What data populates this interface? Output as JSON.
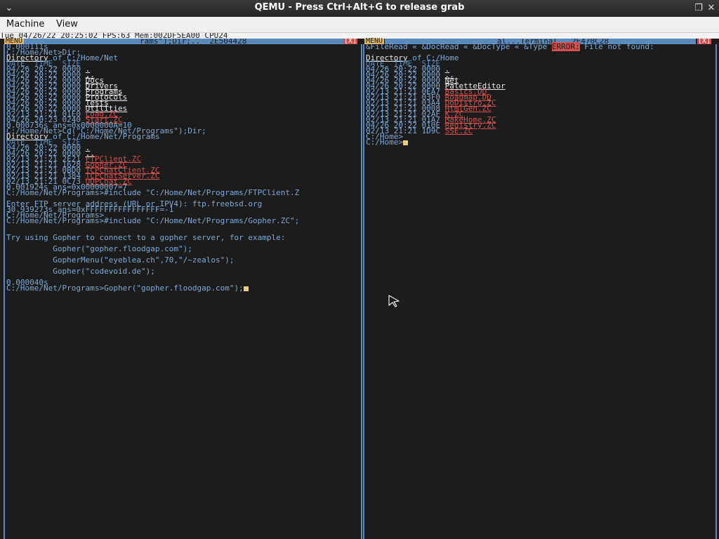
{
  "window": {
    "title": "QEMU - Press Ctrl+Alt+G to release grab",
    "collapse_icon": "⌄",
    "restore_icon": "❐",
    "close_icon": "✕"
  },
  "menubar": {
    "machine": "Machine",
    "view": "View"
  },
  "statusbar": {
    "text": "Tue 04/26/22 20:25:02 FPS:63 Mem:002DF5EA00 CPU24"
  },
  "left_window": {
    "menu_tag": "MENU",
    "title": "rams\");Dir;..  2E504428",
    "close_tag": "[X]",
    "lines": {
      "l0": "0.000111s",
      "l1": "C:/Home/Net>Dir;",
      "l2_a": "Directory",
      "l2_b": " of C:/Home/Net",
      "l3": "DATE_ TIME_ SIZE",
      "r1": "04/26 20:22 0000 ",
      "r1n": ".",
      "r2": "04/26 20:22 0000 ",
      "r2n": "..",
      "r3": "04/26 20:22 0000 ",
      "r3n": "Docs",
      "r4": "04/26 20:22 0000 ",
      "r4n": "Drivers",
      "r5": "04/26 20:22 0000 ",
      "r5n": "Programs",
      "r6": "04/26 20:22 0000 ",
      "r6n": "Protocols",
      "r7": "04/26 20:22 0000 ",
      "r7n": "Tests",
      "r8": "04/26 20:22 0000 ",
      "r8n": "Utilities",
      "r9": "02/13 21:21 01E0 ",
      "r9n": "Load.ZC",
      "r10": "04/26 20:23 0240 ",
      "r10n": "Start.ZC",
      "s1": "0.000736s ans=0x0000000A=10",
      "s2": "C:/Home/Net>Cd(\"C:/Home/Net/Programs\");Dir;",
      "d2_a": "Directory",
      "d2_b": " of C:/Home/Net/Programs",
      "d2h": "DATE_ TIME_ SIZE",
      "p1": "04/26 20:22 0000 ",
      "p1n": ".",
      "p2": "04/26 20:22 0000 ",
      "p2n": "..",
      "p3": "02/13 21:21 2E21 ",
      "p3n": "FTPClient.ZC",
      "p4": "02/13 21:21 1628 ",
      "p4n": "Gopher.ZC",
      "p5": "02/13 21:21 0BD0 ",
      "p5n": "TCPChatClient.ZC",
      "p6": "02/13 21:21 1384 ",
      "p6n": "TCPChatServer.ZC",
      "p7": "02/13 21:21 0C73 ",
      "p7n": "UDPChat.ZC",
      "t1": "0.001924s ans=0x00000007=7",
      "t2": "C:/Home/Net/Programs>#include \"C:/Home/Net/Programs/FTPClient.Z",
      "t3": "Enter FTP server address (URL or IPV4): ftp.freebsd.org",
      "t4": "30.939273s ans=0xFFFFFFFFFFFFFFFF=-1",
      "t5": "C:/Home/Net/Programs>",
      "t6": "C:/Home/Net/Programs>#include \"C:/Home/Net/Programs/Gopher.ZC\";",
      "t7": "Try using Gopher to connect to a gopher server, for example:",
      "t8": "          Gopher(\"gopher.floodgap.com\");",
      "t9": "          GopherMenu(\"eyeblea.ch\",70,\"/~zealos\");",
      "t10": "          Gopher(\"codevoid.de\");",
      "t11": "0.000040s",
      "t12": "C:/Home/Net/Programs>Gopher(\"gopher.floodgap.com\");"
    }
  },
  "right_window": {
    "menu_tag": "MENU",
    "title": "al...Terminal.  2E470C28",
    "close_tag": "[X]",
    "lines": {
      "e1": "&FileRead « &DocRead « &DocType « &Type ",
      "e1_err": "ERROR:",
      "e1_b": " File not found:",
      "d_a": "Directory",
      "d_b": " of C:/Home",
      "dh": "DATE_ TIME_ SIZE",
      "h1": "04/26 20:22 0000 ",
      "h1n": ".",
      "h2": "04/26 20:22 0000 ",
      "h2n": "..",
      "h3": "04/26 20:22 0000 ",
      "h3n": "Net",
      "h4": "04/26 20:22 0000 ",
      "h4n": "PaletteEditor",
      "h5": "02/13 21:21 0EA7 ",
      "h5n": "Basics.DD",
      "h6": "02/13 21:21 03F0 ",
      "h6n": "Roadmap.DD",
      "h7": "02/13 21:21 03A4 ",
      "h7n": "DoDistro.ZC",
      "h8": "02/13 21:21 0008 ",
      "h8n": "HtmlGen.ZC",
      "h9": "02/13 21:21 02AF ",
      "h9n": "K.ZC",
      "h10": "02/13 21:21 01A7 ",
      "h10n": "MakeHome.ZC",
      "h11": "04/26 20:22 010E ",
      "h11n": "Registry.ZC",
      "h12": "02/13 21:21 1D9C ",
      "h12n": "SSE.ZC",
      "c1": "C:/Home>",
      "c2": "C:/Home>"
    }
  },
  "colors": {
    "border": "#5b8bbd",
    "text": "#7fa9d6",
    "file": "#d05050",
    "dir": "#e8e8e8",
    "background": "#1c1c1c"
  }
}
